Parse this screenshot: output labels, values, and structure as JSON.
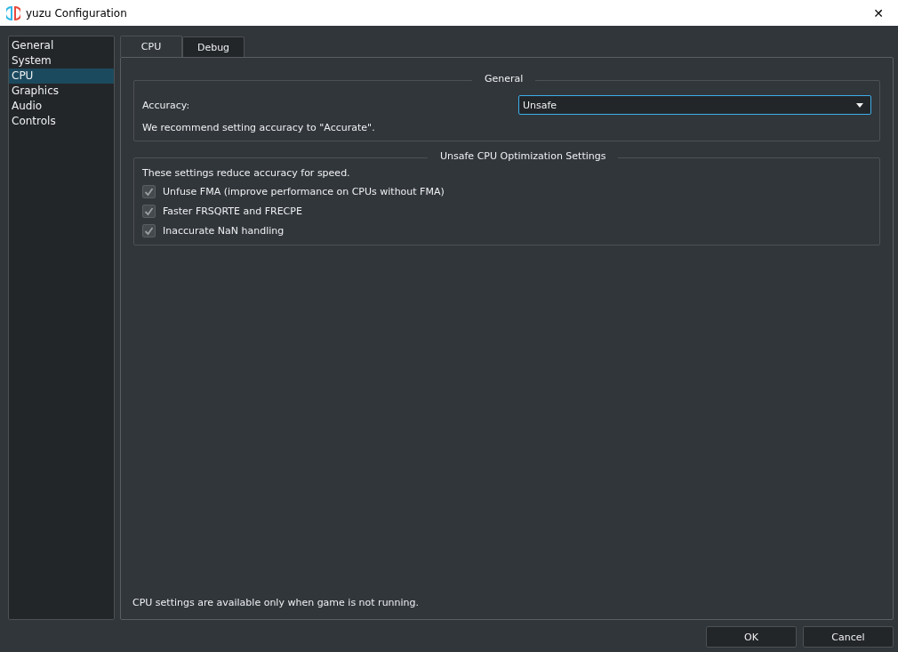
{
  "window": {
    "title": "yuzu Configuration",
    "close": "✕"
  },
  "sidebar": {
    "items": [
      {
        "label": "General",
        "selected": false
      },
      {
        "label": "System",
        "selected": false
      },
      {
        "label": "CPU",
        "selected": true
      },
      {
        "label": "Graphics",
        "selected": false
      },
      {
        "label": "Audio",
        "selected": false
      },
      {
        "label": "Controls",
        "selected": false
      }
    ]
  },
  "tabs": [
    {
      "label": "CPU",
      "selected": true
    },
    {
      "label": "Debug",
      "selected": false
    }
  ],
  "general_group": {
    "title": "General",
    "accuracy_label": "Accuracy:",
    "accuracy_value": "Unsafe",
    "note": "We recommend setting accuracy to \"Accurate\"."
  },
  "unsafe_group": {
    "title": "Unsafe CPU Optimization Settings",
    "description": "These settings reduce accuracy for speed.",
    "options": [
      {
        "label": "Unfuse FMA (improve performance on CPUs without FMA)",
        "checked": true,
        "disabled": true
      },
      {
        "label": "Faster FRSQRTE and FRECPE",
        "checked": true,
        "disabled": true
      },
      {
        "label": "Inaccurate NaN handling",
        "checked": true,
        "disabled": true
      }
    ]
  },
  "footer_note": "CPU settings are available only when game is not running.",
  "buttons": [
    "OK",
    "Cancel"
  ]
}
